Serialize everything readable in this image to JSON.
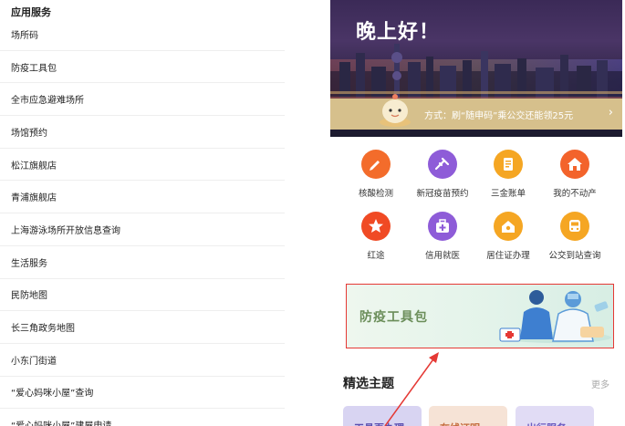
{
  "left_panel": {
    "section_title": "应用服务",
    "items": [
      "场所码",
      "防疫工具包",
      "全市应急避难场所",
      "场馆预约",
      "松江旗舰店",
      "青浦旗舰店",
      "上海游泳场所开放信息查询",
      "生活服务",
      "民防地图",
      "长三角政务地图",
      "小东门街道",
      "“爱心妈咪小屋”查询",
      "“爱心妈咪小屋”建屋申请"
    ]
  },
  "phone": {
    "greeting": "晚上好！",
    "ticker_text": "方式：刷“随申码”乘公交还能领25元",
    "ticker_chevron": "›",
    "grid": [
      {
        "label": "核酸检测",
        "color": "#f36c2b",
        "icon": "pen-icon"
      },
      {
        "label": "新冠疫苗预约",
        "color": "#8e5cd8",
        "icon": "syringe-icon"
      },
      {
        "label": "三金账单",
        "color": "#f5a623",
        "icon": "bill-icon"
      },
      {
        "label": "我的不动产",
        "color": "#f3632b",
        "icon": "house-icon"
      },
      {
        "label": "红途",
        "color": "#f04a24",
        "icon": "star-icon"
      },
      {
        "label": "信用就医",
        "color": "#8e5cd8",
        "icon": "medical-kit-icon"
      },
      {
        "label": "居住证办理",
        "color": "#f5a623",
        "icon": "home-icon"
      },
      {
        "label": "公交到站查询",
        "color": "#f5a623",
        "icon": "bus-icon"
      }
    ],
    "toolkit_title": "防疫工具包",
    "section_title": "精选主题",
    "more_label": "更多",
    "cards": [
      {
        "label": "工具页办理",
        "color": "#d8d4f2",
        "text_color": "#5b4fb0"
      },
      {
        "label": "在线证明",
        "color": "#f6e3d6",
        "text_color": "#c46a3c"
      },
      {
        "label": "出行服务",
        "color": "#e1dcf5",
        "text_color": "#6b5bc0"
      }
    ]
  },
  "colors": {
    "annotation_red": "#e53935",
    "ticker_bg": "#d6c08c"
  }
}
